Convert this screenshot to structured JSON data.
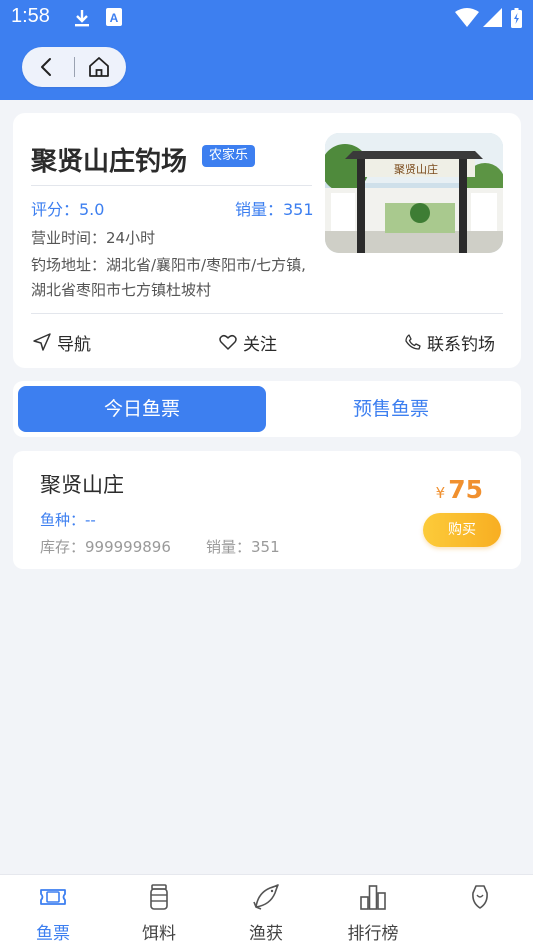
{
  "status_bar": {
    "time": "1:58",
    "icons": [
      "download-icon",
      "a-notification-icon",
      "wifi-icon",
      "signal-icon",
      "battery-icon"
    ]
  },
  "nav_capsule": {
    "back_icon": "chevron-left-icon",
    "home_icon": "home-icon"
  },
  "shop": {
    "name": "聚贤山庄钓场",
    "tag": "农家乐",
    "rating": "评分：5.0",
    "sales": "销量：351",
    "hours": "营业时间：24小时",
    "address": "钓场地址：湖北省/襄阳市/枣阳市/七方镇,湖北省枣阳市七方镇杜坡村",
    "photo_sign": "聚贤山庄"
  },
  "actions": {
    "navigate": "导航",
    "follow": "关注",
    "contact": "联系钓场"
  },
  "tabs": {
    "today": "今日鱼票",
    "presale": "预售鱼票",
    "active": "today"
  },
  "ticket": {
    "name": "聚贤山庄",
    "species": "鱼种：--",
    "stock": "库存：999999896",
    "sales": "销量：351",
    "currency": "¥",
    "price": "75",
    "buy_label": "购买"
  },
  "bottom_nav": [
    {
      "label": "鱼票",
      "icon": "ticket-icon",
      "active": true
    },
    {
      "label": "饵料",
      "icon": "bait-jar-icon",
      "active": false
    },
    {
      "label": "渔获",
      "icon": "fish-icon",
      "active": false
    },
    {
      "label": "排行榜",
      "icon": "ranking-icon",
      "active": false
    },
    {
      "label": "",
      "icon": "trophy-icon",
      "active": false
    }
  ],
  "colors": {
    "primary": "#3d7ff0",
    "price": "#f0902f",
    "buy_button": "#f8ae22",
    "background": "#f2f4f8"
  }
}
